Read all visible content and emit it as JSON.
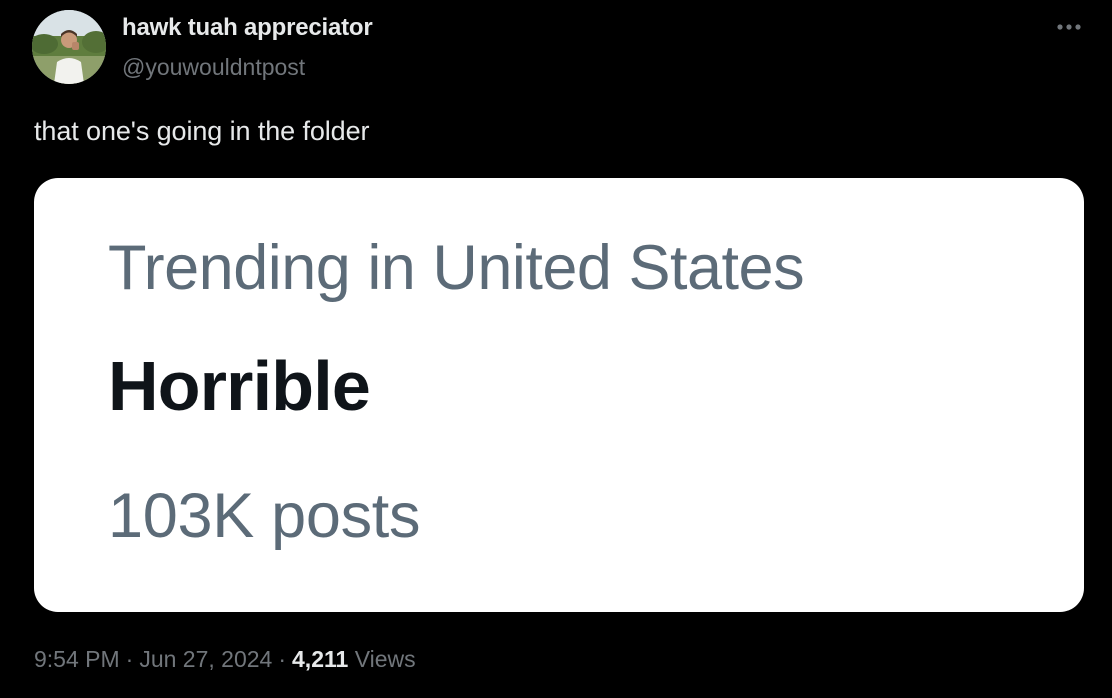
{
  "author": {
    "display_name": "hawk tuah appreciator",
    "handle": "@youwouldntpost",
    "avatar_icon": "profile-photo-avatar"
  },
  "more_icon": "ellipsis-icon",
  "tweet_text": "that one's going in the folder",
  "media": {
    "trend_context": "Trending in United States",
    "trend_topic": "Horrible",
    "trend_count": "103K posts"
  },
  "meta": {
    "time": "9:54 PM",
    "separator": "·",
    "date": "Jun 27, 2024",
    "views_count": "4,211",
    "views_label": "Views"
  },
  "colors": {
    "background": "#000000",
    "primary_text": "#e7e9ea",
    "secondary_text": "#71767b",
    "card_background": "#ffffff",
    "trend_gray": "#5c6b78",
    "trend_topic": "#0f1419"
  }
}
